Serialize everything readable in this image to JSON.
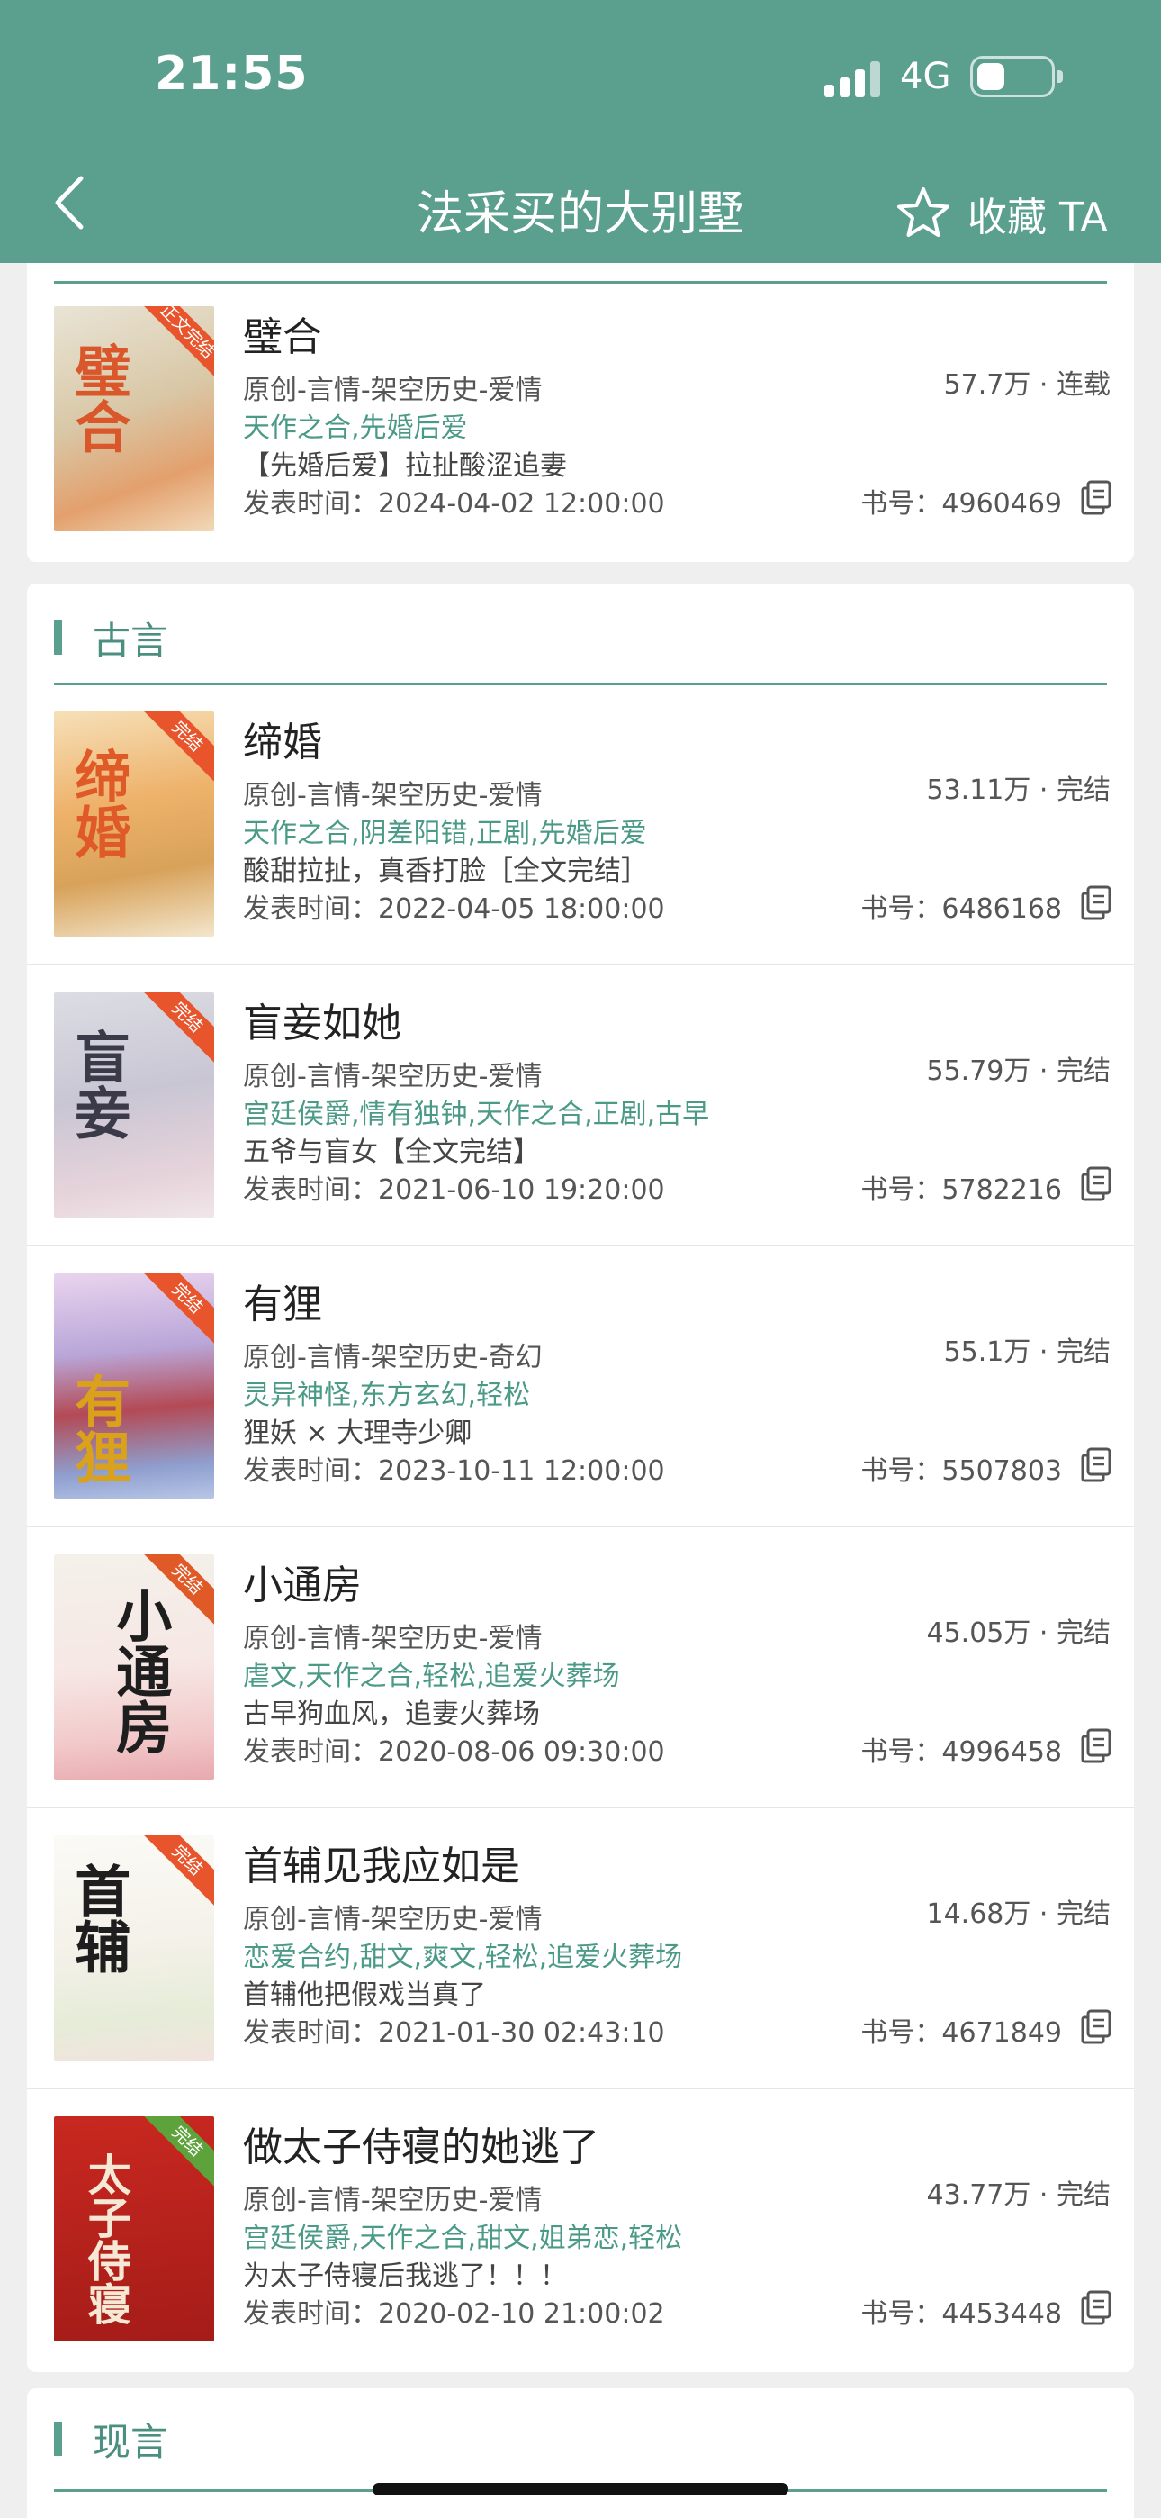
{
  "status_bar": {
    "time": "21:55",
    "network": "4G"
  },
  "header": {
    "title": "法采买的大别墅",
    "favorite_label": "收藏 TA"
  },
  "colors": {
    "accent": "#5b9f8e",
    "tag": "#4a9a86",
    "ribbon": "#e8542b"
  },
  "top_book": {
    "name": "璧合",
    "category": "原创-言情-架空历史-爱情",
    "tags": "天作之合,先婚后爱",
    "desc": "【先婚后爱】拉扯酸涩追妻",
    "date": "发表时间：2024-04-02 12:00:00",
    "stat": "57.7万 · 连载",
    "book_id": "书号：4960469",
    "ribbon": "正文完结",
    "cover_text": "璧合"
  },
  "sections": [
    {
      "title": "古言",
      "books": [
        {
          "name": "缔婚",
          "category": "原创-言情-架空历史-爱情",
          "tags": "天作之合,阴差阳错,正剧,先婚后爱",
          "desc": "酸甜拉扯，真香打脸［全文完结］",
          "date": "发表时间：2022-04-05 18:00:00",
          "stat": "53.11万 · 完结",
          "book_id": "书号：6486168",
          "ribbon": "完结",
          "cover_text": "缔婚"
        },
        {
          "name": "盲妾如她",
          "category": "原创-言情-架空历史-爱情",
          "tags": "宫廷侯爵,情有独钟,天作之合,正剧,古早",
          "desc": "五爷与盲女【全文完结】",
          "date": "发表时间：2021-06-10 19:20:00",
          "stat": "55.79万 · 完结",
          "book_id": "书号：5782216",
          "ribbon": "完结",
          "cover_text": "盲妾"
        },
        {
          "name": "有狸",
          "category": "原创-言情-架空历史-奇幻",
          "tags": "灵异神怪,东方玄幻,轻松",
          "desc": "狸妖 × 大理寺少卿",
          "date": "发表时间：2023-10-11 12:00:00",
          "stat": "55.1万 · 完结",
          "book_id": "书号：5507803",
          "ribbon": "完结",
          "cover_text": "有狸"
        },
        {
          "name": "小通房",
          "category": "原创-言情-架空历史-爱情",
          "tags": "虐文,天作之合,轻松,追爱火葬场",
          "desc": "古早狗血风，追妻火葬场",
          "date": "发表时间：2020-08-06 09:30:00",
          "stat": "45.05万 · 完结",
          "book_id": "书号：4996458",
          "ribbon": "完结",
          "cover_text": "小通房"
        },
        {
          "name": "首辅见我应如是",
          "category": "原创-言情-架空历史-爱情",
          "tags": "恋爱合约,甜文,爽文,轻松,追爱火葬场",
          "desc": "首辅他把假戏当真了",
          "date": "发表时间：2021-01-30 02:43:10",
          "stat": "14.68万 · 完结",
          "book_id": "书号：4671849",
          "ribbon": "完结",
          "cover_text": "首辅"
        },
        {
          "name": "做太子侍寝的她逃了",
          "category": "原创-言情-架空历史-爱情",
          "tags": "宫廷侯爵,天作之合,甜文,姐弟恋,轻松",
          "desc": "为太子侍寝后我逃了！！！",
          "date": "发表时间：2020-02-10 21:00:02",
          "stat": "43.77万 · 完结",
          "book_id": "书号：4453448",
          "ribbon": "完结",
          "cover_text": "太子侍寝"
        }
      ]
    },
    {
      "title": "现言",
      "books": []
    }
  ]
}
